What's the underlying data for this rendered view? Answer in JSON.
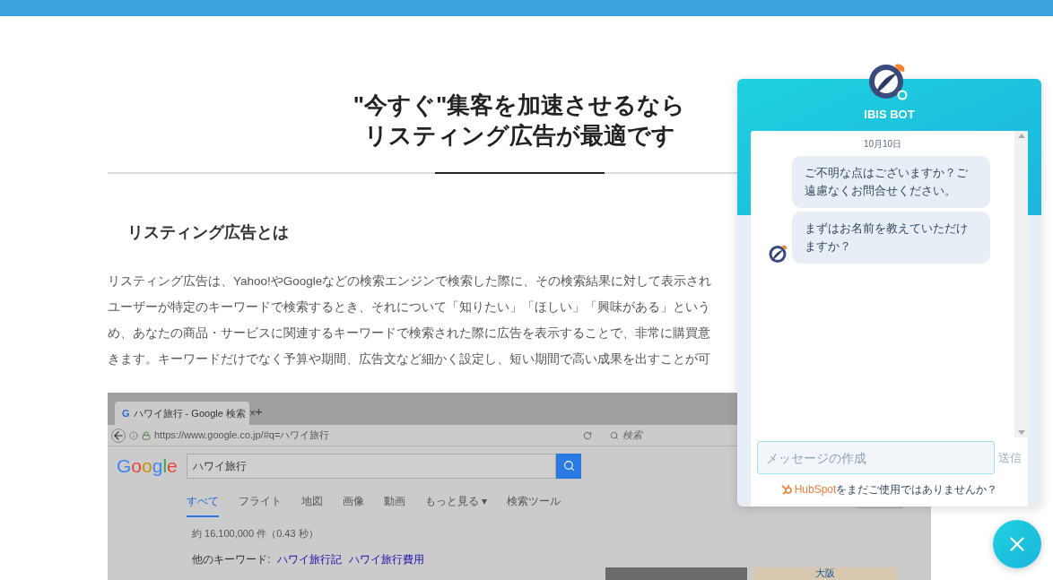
{
  "article": {
    "heading": [
      "\"今すぐ\"集客を加速させるなら",
      "リスティング広告が最適です"
    ],
    "subheading": "リスティング広告とは",
    "paragraph_lines": [
      "リスティング広告は、Yahoo!やGoogleなどの検索エンジンで検索した際に、その検索結果に対して表示され",
      "ユーザーが特定のキーワードで検索するとき、それについて「知りたい」「ほしい」「興味がある」という",
      "め、あなたの商品・サービスに関連するキーワードで検索された際に広告を表示することで、非常に購買意",
      "きます。キーワードだけでなく予算や期間、広告文など細かく設定し、短い期間で高い成果を出すことが可"
    ]
  },
  "screenshot": {
    "favicon": "G",
    "tab_title": "ハワイ旅行 - Google 検索",
    "tab_close": "×",
    "new_tab": "+",
    "url": "https://www.google.co.jp/#q=ハワイ旅行",
    "browser_search_placeholder": "検索",
    "logo": "Google",
    "query": "ハワイ旅行",
    "nav": [
      {
        "label": "すべて",
        "selected": true
      },
      {
        "label": "フライト",
        "selected": false
      },
      {
        "label": "地図",
        "selected": false
      },
      {
        "label": "画像",
        "selected": false
      },
      {
        "label": "動画",
        "selected": false
      },
      {
        "label": "もっと見る ▾",
        "selected": false
      },
      {
        "label": "検索ツール",
        "selected": false
      }
    ],
    "result_count": "約 16,100,000 件（0.43 秒）",
    "related_label": "他のキーワード:",
    "related_links": [
      "ハワイ旅行記",
      "ハワイ旅行費用"
    ],
    "map_label": "大阪"
  },
  "chat": {
    "title": "IBIS BOT",
    "date": "10月10日",
    "messages": [
      {
        "text": "ご不明な点はございますか？ご遠慮なくお問合せください。",
        "avatar": false
      },
      {
        "text": "まずはお名前を教えていただけますか？",
        "avatar": true
      }
    ],
    "input": {
      "placeholder": "メッセージの作成"
    },
    "send": "送信",
    "footer_brand": "HubSpot",
    "footer_text": "をまだご使用ではありませんか？"
  }
}
